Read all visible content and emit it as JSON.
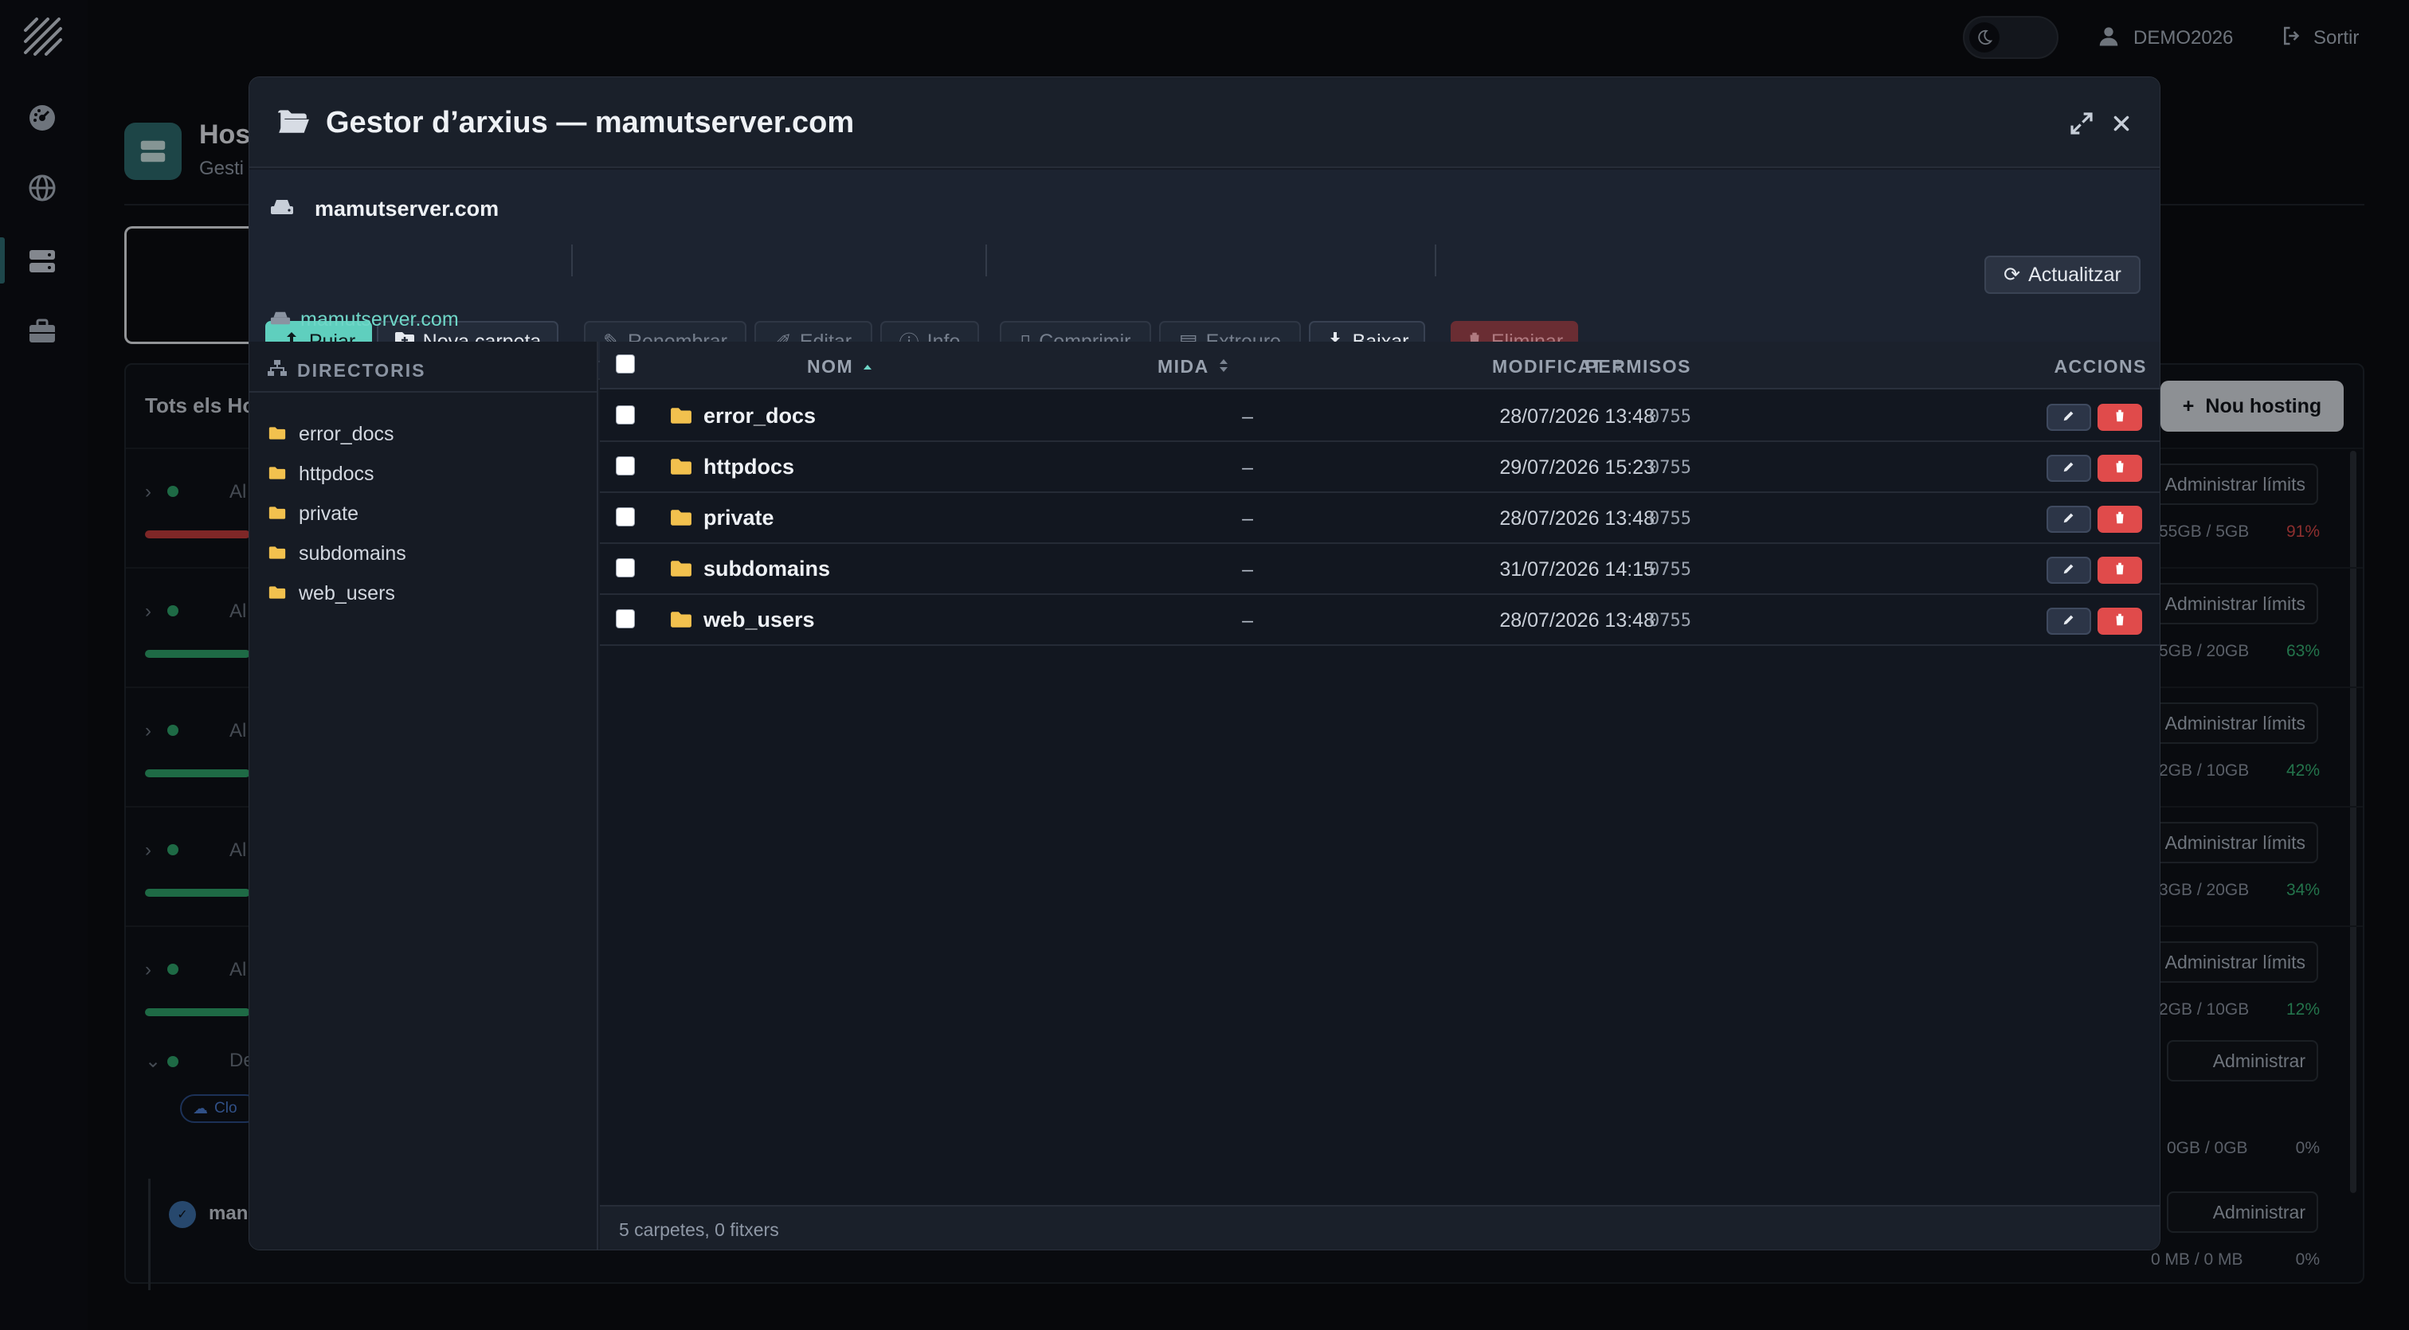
{
  "topbar": {
    "user": "DEMO2026",
    "logout": "Sortir"
  },
  "background_page": {
    "title": "Host",
    "subtitle": "Gesti",
    "table_title": "Tots els Ho",
    "new_hosting": "Nou hosting",
    "rows": [
      {
        "label": "Al",
        "usage": "55GB / 5GB",
        "percent": "91%",
        "percent_color": "#d84848",
        "bar_color": "#c23d3d",
        "admin": "Administrar límits"
      },
      {
        "label": "Al",
        "usage": "5GB / 20GB",
        "percent": "63%",
        "percent_color": "#36b173",
        "bar_color": "#2ea36b",
        "admin": "Administrar límits"
      },
      {
        "label": "Al",
        "usage": "2GB / 10GB",
        "percent": "42%",
        "percent_color": "#36b173",
        "bar_color": "#2ea36b",
        "admin": "Administrar límits"
      },
      {
        "label": "Al",
        "usage": "3GB / 20GB",
        "percent": "34%",
        "percent_color": "#36b173",
        "bar_color": "#2ea36b",
        "admin": "Administrar límits"
      },
      {
        "label": "Al",
        "usage": "2GB / 10GB",
        "percent": "12%",
        "percent_color": "#36b173",
        "bar_color": "#2ea36b",
        "admin": "Administrar límits"
      }
    ],
    "expanded_row": {
      "label": "De",
      "admin": "Administrar",
      "usage": "0GB / 0GB",
      "percent": "0%",
      "badge": "Clo"
    },
    "sub_row": {
      "label": "man",
      "admin": "Administrar",
      "usage": "0 MB / 0 MB",
      "percent": "0%"
    }
  },
  "modal": {
    "title": "Gestor d’arxius — mamutserver.com",
    "server": "mamutserver.com",
    "refresh": "Actualitzar",
    "breadcrumb": "mamutserver.com",
    "toolbar": {
      "upload": "Pujar",
      "new_folder": "Nova carpeta",
      "rename": "Renombrar",
      "edit": "Editar",
      "info": "Info",
      "compress": "Comprimir",
      "extract": "Extreure",
      "download": "Baixar",
      "delete": "Eliminar"
    },
    "directories_title": "DIRECTORIS",
    "tree": [
      "error_docs",
      "httpdocs",
      "private",
      "subdomains",
      "web_users"
    ],
    "columns": {
      "name": "NOM",
      "size": "MIDA",
      "modified": "MODIFICAT",
      "permissions": "PERMISOS",
      "actions": "ACCIONS"
    },
    "files": [
      {
        "name": "error_docs",
        "size": "–",
        "modified": "28/07/2026 13:48",
        "permissions": "0755"
      },
      {
        "name": "httpdocs",
        "size": "–",
        "modified": "29/07/2026 15:23",
        "permissions": "0755"
      },
      {
        "name": "private",
        "size": "–",
        "modified": "28/07/2026 13:48",
        "permissions": "0755"
      },
      {
        "name": "subdomains",
        "size": "–",
        "modified": "31/07/2026 14:15",
        "permissions": "0755"
      },
      {
        "name": "web_users",
        "size": "–",
        "modified": "28/07/2026 13:48",
        "permissions": "0755"
      }
    ],
    "footer": "5 carpetes, 0 fitxers"
  },
  "colors": {
    "accent": "#5fcfbe",
    "folder": "#f2c14e",
    "danger": "#e04b4b"
  }
}
